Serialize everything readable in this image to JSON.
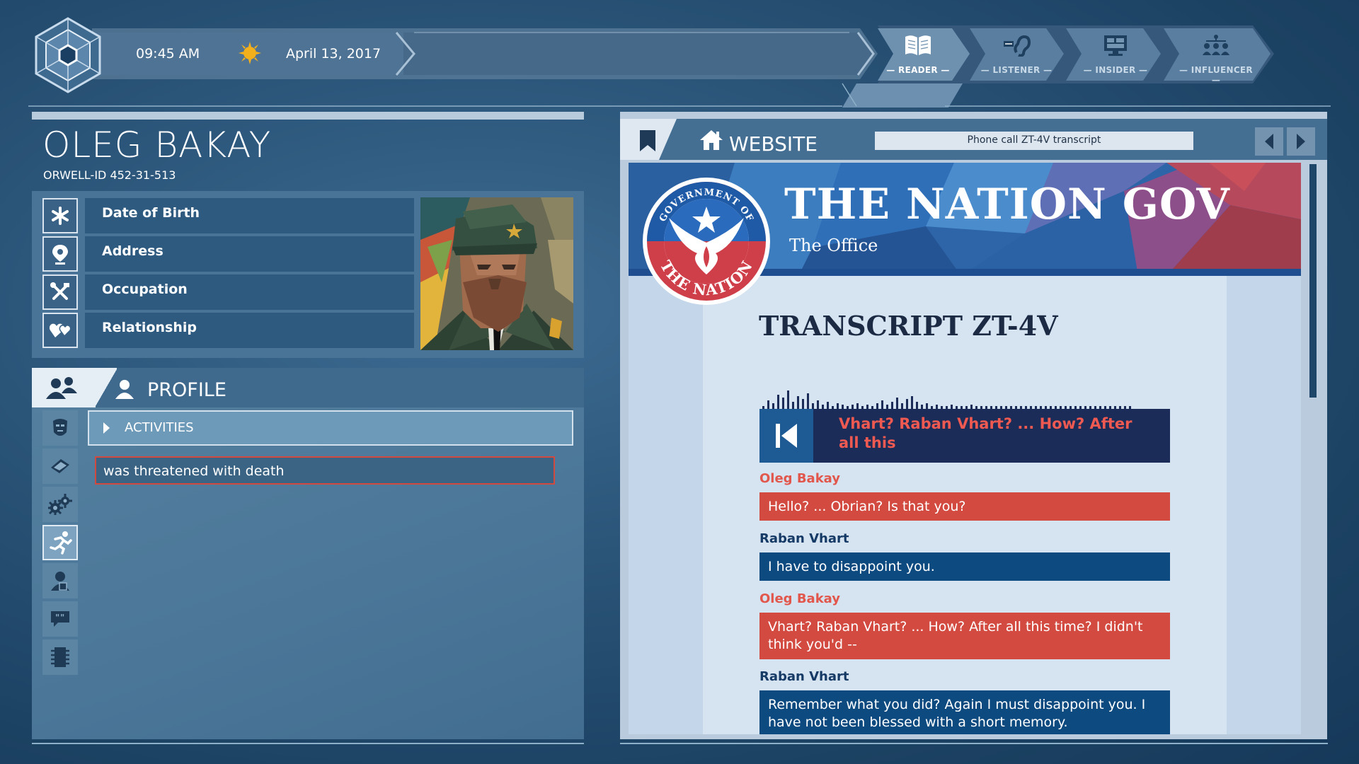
{
  "topbar": {
    "time": "09:45 AM",
    "date": "April 13, 2017",
    "tabs": [
      {
        "label": "— READER —",
        "icon": "book-icon",
        "active": true
      },
      {
        "label": "— LISTENER —",
        "icon": "ear-icon",
        "active": false
      },
      {
        "label": "— INSIDER —",
        "icon": "monitor-icon",
        "active": false
      },
      {
        "label": "— INFLUENCER —",
        "icon": "network-icon",
        "active": false
      }
    ]
  },
  "person": {
    "name": "OLEG BAKAY",
    "orwell_id": "ORWELL-ID  452-31-513",
    "fields": [
      {
        "label": "Date of Birth",
        "icon": "asterisk-icon"
      },
      {
        "label": "Address",
        "icon": "location-pin-icon"
      },
      {
        "label": "Occupation",
        "icon": "tools-icon"
      },
      {
        "label": "Relationship",
        "icon": "hearts-icon"
      }
    ]
  },
  "profile": {
    "tab_label": "PROFILE",
    "category": "ACTIVITIES",
    "items": [
      "was threatened with death"
    ],
    "side_icons": [
      "face-icon",
      "book-icon",
      "gears-icon",
      "running-icon",
      "person-icon",
      "speech-bubble-icon",
      "chip-icon"
    ]
  },
  "website": {
    "label": "WEBSITE",
    "url": "Phone call ZT-4V transcript",
    "site_title": "THE NATION GOV",
    "site_subtitle": "The Office",
    "seal_top": "GOVERNMENT OF",
    "seal_bottom": "THE NATION",
    "transcript_title": "TRANSCRIPT ZT-4V",
    "player_text": "Vhart? Raban Vhart? ... How? After all this",
    "messages": [
      {
        "speaker": "Oleg Bakay",
        "text": "Hello? ... Obrian? Is that you?",
        "side": "red"
      },
      {
        "speaker": "Raban Vhart",
        "text": "I have to disappoint you.",
        "side": "blue"
      },
      {
        "speaker": "Oleg Bakay",
        "text": "Vhart? Raban Vhart? ... How? After all this time? I didn't think you'd --",
        "side": "red"
      },
      {
        "speaker": "Raban Vhart",
        "text": "Remember what you did? Again I must disappoint you. I have not been blessed with a short memory.",
        "side": "blue"
      }
    ]
  },
  "colors": {
    "red": "#d24a40",
    "navy": "#0d4a80",
    "speaker_red": "#e2574c",
    "speaker_blue": "#153a66"
  }
}
